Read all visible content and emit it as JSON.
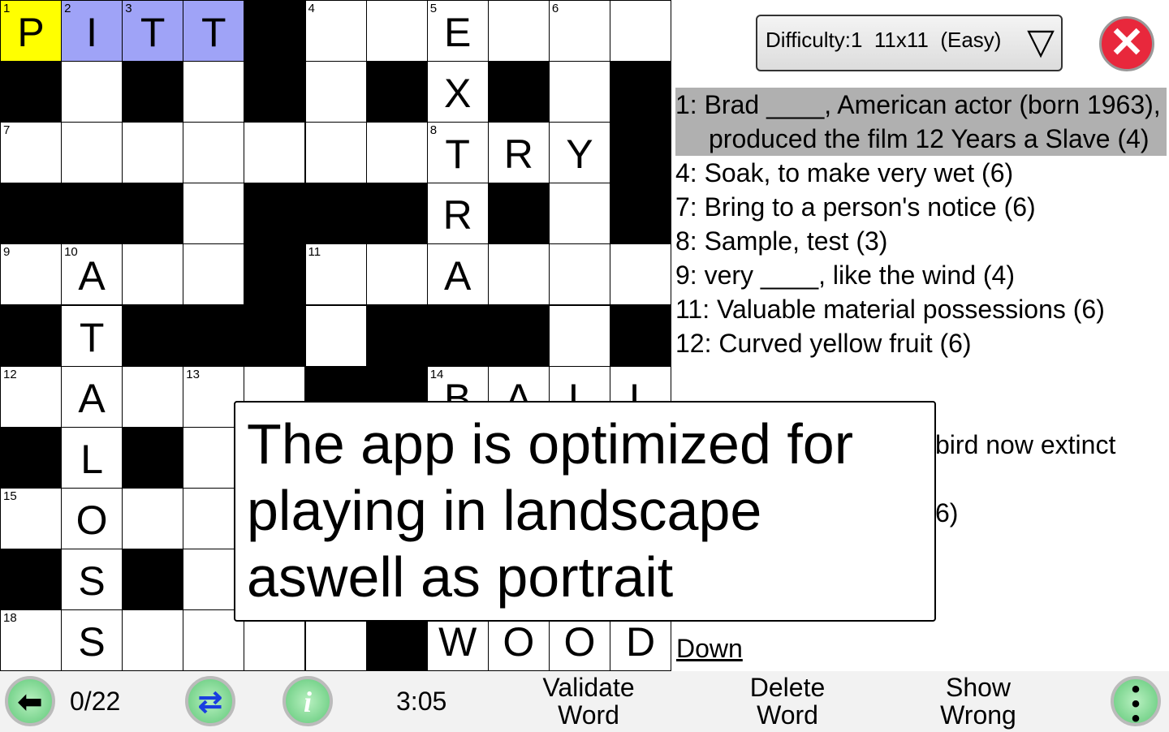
{
  "grid": {
    "rows": [
      "PITT#..E...",
      "#.#.#.#X#.#",
      ".......TRY#",
      "###.###R#.#",
      ".A..#..A...",
      "#T###.###.#",
      ".A...##BALL",
      "#L#.......?",
      ".O.........",
      "#S#........",
      ".S....#WOOD"
    ],
    "numbers": {
      "0,0": "1",
      "0,1": "2",
      "0,2": "3",
      "0,5": "4",
      "0,7": "5",
      "0,9": "6",
      "2,0": "7",
      "2,7": "8",
      "4,0": "9",
      "4,1": "10",
      "4,5": "11",
      "6,0": "12",
      "6,3": "13",
      "6,7": "14",
      "8,0": "15",
      "10,0": "18"
    },
    "current": "0,0",
    "word": [
      "0,1",
      "0,2",
      "0,3"
    ]
  },
  "header": {
    "difficulty": "Difficulty:1  11x11  (Easy)",
    "dropdown_icon": "triangle-down",
    "close_icon": "x-circle"
  },
  "clues": {
    "across": [
      "1: Brad ____, American actor (born 1963), produced the film 12 Years a Slave (4)",
      "4: Soak, to make very wet (6)",
      "7: Bring to a person's notice (6)",
      "8: Sample, test (3)",
      "9: very ____, like the wind (4)",
      "11: Valuable material possessions (6)",
      "12: Curved yellow fruit (6)"
    ],
    "fragments": [
      "bird now extinct",
      "6)"
    ],
    "down_label": "Down"
  },
  "popup": {
    "message": "The app is optimized for playing in landscape aswell as portrait"
  },
  "toolbar": {
    "progress": "0/22",
    "timer": "3:05",
    "validate": "Validate Word",
    "delete": "Delete Word",
    "show_wrong": "Show Wrong",
    "back_icon": "arrow-left",
    "swap_icon": "swap-arrows",
    "info_icon": "info",
    "menu_icon": "vertical-dots"
  },
  "colors": {
    "current_cell": "#ffff00",
    "word_cells": "#9fa3f7",
    "selected_clue": "#b0b0b0",
    "close": "#e8283c"
  }
}
